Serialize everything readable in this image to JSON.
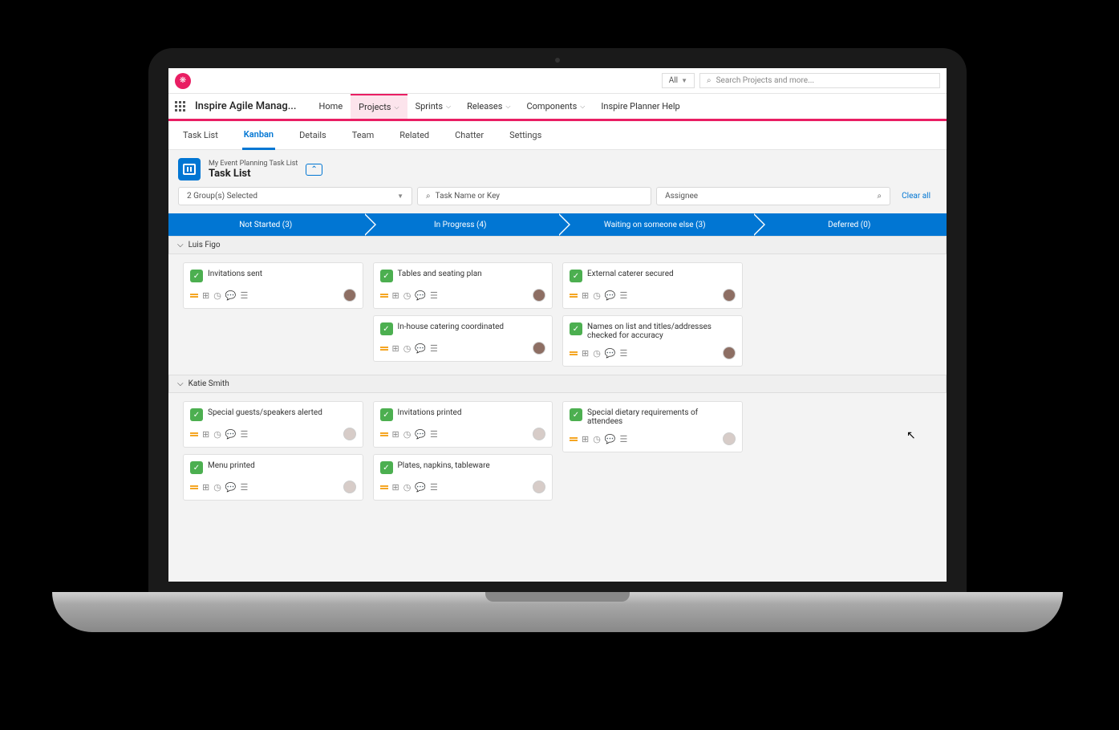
{
  "topbar": {
    "search_scope": "All",
    "search_placeholder": "Search Projects and more..."
  },
  "navbar": {
    "app_name": "Inspire Agile Manag...",
    "items": [
      {
        "label": "Home",
        "dropdown": false
      },
      {
        "label": "Projects",
        "dropdown": true,
        "active": true
      },
      {
        "label": "Sprints",
        "dropdown": true
      },
      {
        "label": "Releases",
        "dropdown": true
      },
      {
        "label": "Components",
        "dropdown": true
      },
      {
        "label": "Inspire Planner Help",
        "dropdown": false
      }
    ]
  },
  "subtabs": [
    "Task List",
    "Kanban",
    "Details",
    "Team",
    "Related",
    "Chatter",
    "Settings"
  ],
  "subtab_active": "Kanban",
  "tasklist": {
    "subtitle": "My Event Planning Task List",
    "title": "Task List"
  },
  "filters": {
    "group_selected": "2 Group(s) Selected",
    "task_name_placeholder": "Task Name or Key",
    "assignee_placeholder": "Assignee",
    "clear_all": "Clear all"
  },
  "statuses": [
    {
      "label": "Not Started",
      "count": 3
    },
    {
      "label": "In Progress",
      "count": 4
    },
    {
      "label": "Waiting on someone else",
      "count": 3
    },
    {
      "label": "Deferred",
      "count": 0
    }
  ],
  "swimlanes": [
    {
      "name": "Luis Figo",
      "avatar": "a1",
      "columns": [
        [
          "Invitations sent"
        ],
        [
          "Tables and seating plan",
          "In-house catering coordinated"
        ],
        [
          "External caterer secured",
          "Names on list and titles/addresses checked for accuracy"
        ],
        []
      ]
    },
    {
      "name": "Katie Smith",
      "avatar": "a2",
      "columns": [
        [
          "Special guests/speakers alerted",
          "Menu printed"
        ],
        [
          "Invitations printed",
          "Plates, napkins, tableware"
        ],
        [
          "Special dietary requirements of attendees"
        ],
        []
      ]
    }
  ]
}
